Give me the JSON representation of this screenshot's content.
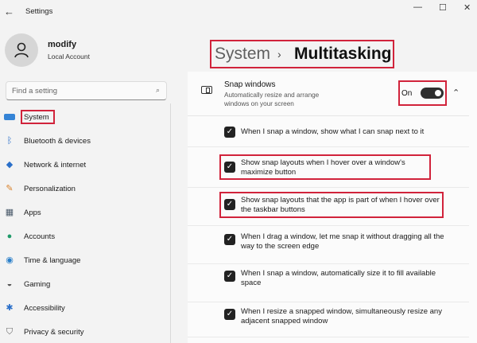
{
  "app": {
    "back_icon": "back-arrow-icon",
    "title": "Settings",
    "controls": [
      "minimize-icon",
      "maximize-icon",
      "close-icon"
    ]
  },
  "account": {
    "name": "modify",
    "type": "Local Account"
  },
  "search": {
    "placeholder": "Find a setting"
  },
  "sidebar": {
    "items": [
      {
        "label": "System",
        "icon": "monitor-icon",
        "selected": true
      },
      {
        "label": "Bluetooth & devices",
        "icon": "bluetooth-icon"
      },
      {
        "label": "Network & internet",
        "icon": "wifi-icon"
      },
      {
        "label": "Personalization",
        "icon": "brush-icon"
      },
      {
        "label": "Apps",
        "icon": "apps-icon"
      },
      {
        "label": "Accounts",
        "icon": "person-icon"
      },
      {
        "label": "Time & language",
        "icon": "globe-clock-icon"
      },
      {
        "label": "Gaming",
        "icon": "gamepad-icon"
      },
      {
        "label": "Accessibility",
        "icon": "accessibility-icon"
      },
      {
        "label": "Privacy & security",
        "icon": "shield-icon"
      }
    ]
  },
  "header": {
    "crumb_parent": "System",
    "crumb_separator": "›",
    "crumb_current": "Multitasking"
  },
  "snap": {
    "title": "Snap windows",
    "description": "Automatically resize and arrange windows on your screen",
    "toggle_label": "On",
    "toggle_on": true
  },
  "options": [
    {
      "text": "When I snap a window, show what I can snap next to it",
      "checked": true
    },
    {
      "text": "Show snap layouts when I hover over a window's maximize button",
      "checked": true
    },
    {
      "text": "Show snap layouts that the app is part of when I hover over the taskbar buttons",
      "checked": true
    },
    {
      "text": "When I drag a window, let me snap it without dragging all the way to the screen edge",
      "checked": true
    },
    {
      "text": "When I snap a window, automatically size it to fill available space",
      "checked": true
    },
    {
      "text": "When I resize a snapped window, simultaneously resize any adjacent snapped window",
      "checked": true
    }
  ],
  "colors": {
    "highlight": "#d1233b",
    "accent": "#3584d6",
    "checkbox": "#222222"
  }
}
